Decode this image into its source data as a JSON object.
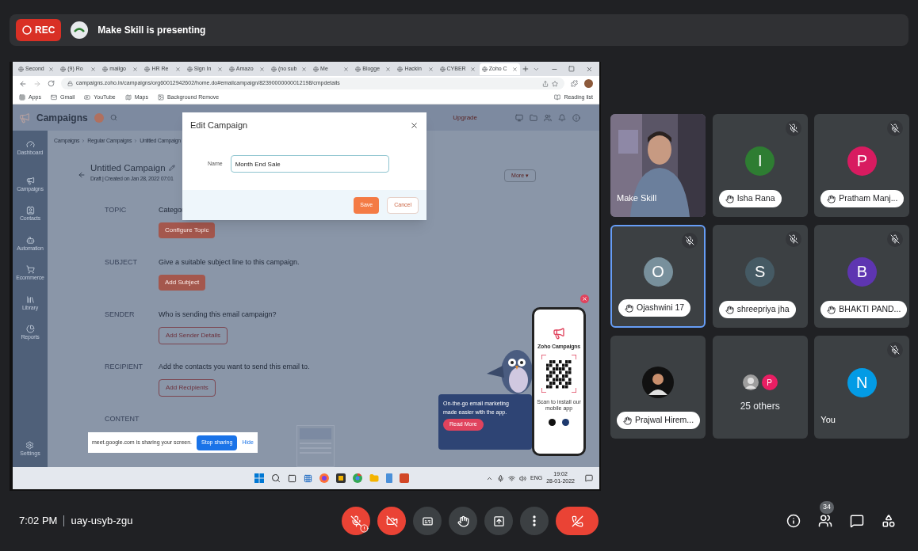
{
  "meeting": {
    "recording_label": "REC",
    "presenter_banner": "Make Skill is presenting"
  },
  "browser": {
    "tabs": [
      {
        "label": "Second",
        "selected": false
      },
      {
        "label": "(9) Ro",
        "selected": false
      },
      {
        "label": "mailgo",
        "selected": false
      },
      {
        "label": "HR Re",
        "selected": false
      },
      {
        "label": "Sign In",
        "selected": false
      },
      {
        "label": "Amazo",
        "selected": false
      },
      {
        "label": "(no sub",
        "selected": false
      },
      {
        "label": "Me",
        "selected": false
      },
      {
        "label": "Blogge",
        "selected": false
      },
      {
        "label": "Hackin",
        "selected": false
      },
      {
        "label": "CYBER",
        "selected": false
      },
      {
        "label": "Zoho C",
        "selected": true
      }
    ],
    "url": "campaigns.zoho.in/campaigns/org60012942602/home.do#emailcampaign/82390000000012198/cmpdetails",
    "bookmarks": [
      "Apps",
      "Gmail",
      "YouTube",
      "Maps",
      "Background Remove"
    ],
    "reading_list": "Reading list"
  },
  "app": {
    "title": "Campaigns",
    "upgrade": "Upgrade",
    "sidebar": [
      "Dashboard",
      "Campaigns",
      "Contacts",
      "Automation",
      "Ecommerce",
      "Library",
      "Reports"
    ],
    "settings": "Settings",
    "breadcrumb": [
      "Campaigns",
      "Regular Campaigns",
      "Untitled Campaign"
    ],
    "campaign_title": "Untitled Campaign",
    "status_line": "Draft | Created on Jan 28, 2022 07:01",
    "more_button": "More ▾",
    "sections": [
      {
        "label": "TOPIC",
        "text": "Categor",
        "button": "Configure Topic",
        "kind": "filled"
      },
      {
        "label": "SUBJECT",
        "text": "Give a suitable subject line to this campaign.",
        "button": "Add Subject",
        "kind": "filled"
      },
      {
        "label": "SENDER",
        "text": "Who is sending this email campaign?",
        "button": "Add Sender Details",
        "kind": "outline"
      },
      {
        "label": "RECIPIENT",
        "text": "Add the contacts you want to send this email to.",
        "button": "Add Recipients",
        "kind": "outline"
      },
      {
        "label": "CONTENT",
        "kind": "empty"
      }
    ]
  },
  "dialog": {
    "title": "Edit Campaign",
    "field_label": "Name",
    "value": "Month End Sale",
    "save": "Save",
    "cancel": "Cancel"
  },
  "promo": {
    "text": "On-the-go email marketing made easier with the app.",
    "button": "Read More",
    "phone_title": "Zoho Campaigns",
    "phone_caption": "Scan to install our mobile app"
  },
  "share_bar": {
    "text": "meet.google.com is sharing your screen.",
    "stop": "Stop sharing",
    "hide": "Hide"
  },
  "taskbar": {
    "language": "ENG",
    "time": "19:02",
    "date": "28-01-2022"
  },
  "participants": [
    {
      "name": "Make Skill",
      "kind": "video",
      "muted": false,
      "hand_raised": false,
      "selected": false
    },
    {
      "name": "Isha Rana",
      "kind": "initial",
      "initial": "I",
      "color": "#2e7d32",
      "muted": true,
      "hand_raised": true,
      "selected": false
    },
    {
      "name": "Pratham Manj...",
      "kind": "initial",
      "initial": "P",
      "color": "#d81b60",
      "muted": true,
      "hand_raised": true,
      "selected": false
    },
    {
      "name": "Ojashwini 17",
      "kind": "initial",
      "initial": "O",
      "color": "#78909c",
      "muted": true,
      "hand_raised": true,
      "selected": true
    },
    {
      "name": "shreepriya jha",
      "kind": "initial",
      "initial": "S",
      "color": "#455a64",
      "muted": true,
      "hand_raised": true,
      "selected": false
    },
    {
      "name": "BHAKTI PAND...",
      "kind": "initial",
      "initial": "B",
      "color": "#5e35b1",
      "muted": true,
      "hand_raised": true,
      "selected": false
    },
    {
      "name": "Prajwal Hirem...",
      "muted": false,
      "hand_raised": true,
      "selected": false
    },
    {
      "name": "25 others",
      "kind": "others",
      "initial": "P",
      "color": "#e91e63",
      "muted": false,
      "hand_raised": false,
      "selected": false
    },
    {
      "name": "You",
      "kind": "initial",
      "initial": "N",
      "color": "#039be5",
      "muted": true,
      "hand_raised": false,
      "selected": false
    }
  ],
  "bottom_bar": {
    "time": "7:02 PM",
    "meeting_code": "uay-usyb-zgu",
    "mic_on": false,
    "camera_on": false,
    "people_count": "34"
  }
}
